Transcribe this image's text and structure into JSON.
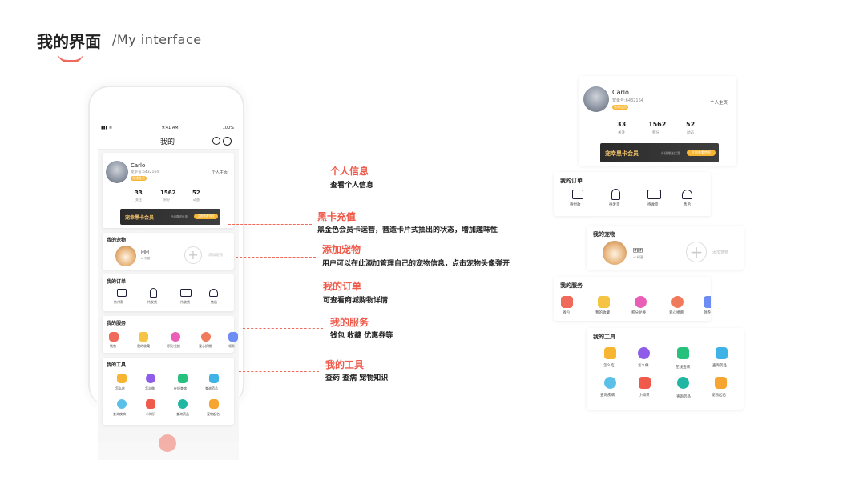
{
  "header": {
    "title_cn": "我的界面",
    "title_en": "/My interface"
  },
  "phone": {
    "status": {
      "time": "9:41 AM",
      "battery": "100%"
    },
    "nav_title": "我的",
    "profile": {
      "name": "Carlo",
      "pet_id": "宠幸号:6432164",
      "level": "普通会员",
      "home_link": "个人主页",
      "stats": [
        {
          "value": "33",
          "label": "关注"
        },
        {
          "value": "1562",
          "label": "积分"
        },
        {
          "value": "52",
          "label": "动态"
        }
      ]
    },
    "black_card": {
      "title": "宠幸黑卡会员",
      "desc": "升级赠送优惠",
      "button": "立即查看特权"
    },
    "pets": {
      "title": "我的宠物",
      "pet_name": "团团",
      "pet_tag": "♂ 柯基",
      "add_label": "添加宠物"
    },
    "orders": {
      "title": "我的订单",
      "items": [
        "待付款",
        "待发货",
        "待收货",
        "售后"
      ]
    },
    "services": {
      "title": "我的服务",
      "items": [
        "钱包",
        "我的收藏",
        "积分兑换",
        "爱心捐赠",
        "领券"
      ]
    },
    "tools": {
      "title": "我的工具",
      "row1": [
        "怎么吃",
        "怎么做",
        "在线查病",
        "查询药品"
      ],
      "row2": [
        "查询疾病",
        "小知识",
        "查询药品",
        "宠物起名"
      ]
    }
  },
  "callouts": [
    {
      "title": "个人信息",
      "desc": "查看个人信息"
    },
    {
      "title": "黑卡充值",
      "desc": "黑金色会员卡运营，营造卡片式抽出的状态，增加趣味性"
    },
    {
      "title": "添加宠物",
      "desc": "用户可以在此添加管理自己的宠物信息，点击宠物头像弹开"
    },
    {
      "title": "我的订单",
      "desc": "可查看商城购物详情"
    },
    {
      "title": "我的服务",
      "desc": "钱包  收藏  优惠券等"
    },
    {
      "title": "我的工具",
      "desc": "查药 查病 宠物知识"
    }
  ],
  "right": {
    "profile": {
      "name": "Carlo",
      "pet_id": "宠幸号:6432164",
      "level": "普通会员",
      "home_link": "个人主页",
      "stats": [
        {
          "value": "33",
          "label": "关注"
        },
        {
          "value": "1562",
          "label": "积分"
        },
        {
          "value": "52",
          "label": "动态"
        }
      ],
      "black_card": {
        "title": "宠幸黑卡会员",
        "desc": "升级赠送优惠",
        "button": "立即查看特权"
      }
    },
    "orders": {
      "title": "我的订单",
      "items": [
        "待付款",
        "待发货",
        "待收货",
        "售后"
      ]
    },
    "pets": {
      "title": "我的宠物",
      "pet_name": "团团",
      "pet_tag": "♂ 柯基",
      "add_label": "添加宠物"
    },
    "services": {
      "title": "我的服务",
      "items": [
        "钱包",
        "我的收藏",
        "积分兑换",
        "爱心捐赠",
        "领券"
      ]
    },
    "tools": {
      "title": "我的工具",
      "row1": [
        "怎么吃",
        "怎么做",
        "在线查病",
        "查询药品"
      ],
      "row2": [
        "查询疾病",
        "小知识",
        "查询药品",
        "宠物起名"
      ]
    }
  },
  "colors": {
    "accent": "#ef6a5a",
    "gold": "#f7b531",
    "card_dark": "#2f2f2f"
  }
}
